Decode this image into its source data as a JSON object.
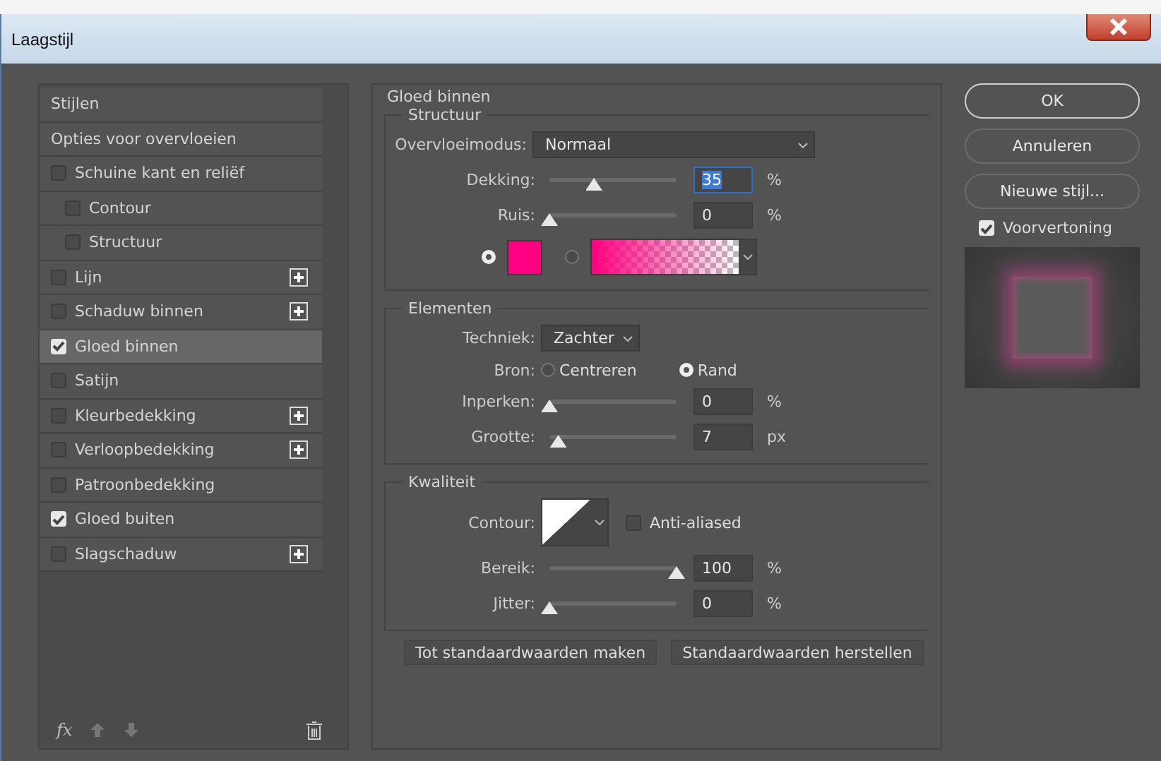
{
  "window": {
    "title": "Laagstijl"
  },
  "styles": [
    {
      "kind": "header",
      "label": "Stijlen",
      "selected": false
    },
    {
      "kind": "header",
      "label": "Opties voor overvloeien",
      "selected": false
    },
    {
      "kind": "check",
      "label": "Schuine kant en reliëf",
      "checked": false,
      "selected": false,
      "addable": false,
      "children": [
        {
          "kind": "check",
          "label": "Contour",
          "checked": false,
          "selected": false,
          "addable": false
        },
        {
          "kind": "check",
          "label": "Structuur",
          "checked": false,
          "selected": false,
          "addable": false
        }
      ]
    },
    {
      "kind": "check",
      "label": "Lijn",
      "checked": false,
      "selected": false,
      "addable": true
    },
    {
      "kind": "check",
      "label": "Schaduw binnen",
      "checked": false,
      "selected": false,
      "addable": true
    },
    {
      "kind": "check",
      "label": "Gloed binnen",
      "checked": true,
      "selected": true,
      "addable": false
    },
    {
      "kind": "check",
      "label": "Satijn",
      "checked": false,
      "selected": false,
      "addable": false
    },
    {
      "kind": "check",
      "label": "Kleurbedekking",
      "checked": false,
      "selected": false,
      "addable": true
    },
    {
      "kind": "check",
      "label": "Verloopbedekking",
      "checked": false,
      "selected": false,
      "addable": true
    },
    {
      "kind": "check",
      "label": "Patroonbedekking",
      "checked": false,
      "selected": false,
      "addable": false
    },
    {
      "kind": "check",
      "label": "Gloed buiten",
      "checked": true,
      "selected": false,
      "addable": false
    },
    {
      "kind": "check",
      "label": "Slagschaduw",
      "checked": false,
      "selected": false,
      "addable": true
    }
  ],
  "styles_footer": {
    "fx": "fx"
  },
  "panel": {
    "title": "Gloed binnen",
    "structure": {
      "title": "Structuur",
      "blend_label": "Overvloeimodus:",
      "blend_value": "Normaal",
      "sliders": [
        {
          "label": "Dekking:",
          "level": 0.35,
          "value": "35",
          "unit": "%",
          "focused": true
        },
        {
          "label": "Ruis:",
          "level": 0,
          "value": "0",
          "unit": "%",
          "focused": false
        }
      ],
      "fill": [
        {
          "kind": "solid",
          "selected": true,
          "color": "#ff0080"
        },
        {
          "kind": "gradient",
          "selected": false,
          "color": "#ff0080"
        }
      ]
    },
    "elements": {
      "title": "Elementen",
      "technique_label": "Techniek:",
      "technique_value": "Zachter",
      "source_label": "Bron:",
      "sources": [
        {
          "label": "Centreren",
          "selected": false
        },
        {
          "label": "Rand",
          "selected": true
        }
      ],
      "sliders": [
        {
          "label": "Inperken:",
          "level": 0,
          "value": "0",
          "unit": "%",
          "focused": false
        },
        {
          "label": "Grootte:",
          "level": 0.07,
          "value": "7",
          "unit": "px",
          "focused": false
        }
      ]
    },
    "quality": {
      "title": "Kwaliteit",
      "contour_label": "Contour:",
      "anti_aliased": {
        "label": "Anti-aliased",
        "checked": false
      },
      "sliders": [
        {
          "label": "Bereik:",
          "level": 1,
          "value": "100",
          "unit": "%",
          "focused": false
        },
        {
          "label": "Jitter:",
          "level": 0,
          "value": "0",
          "unit": "%",
          "focused": false
        }
      ]
    },
    "buttons": [
      "Tot standaardwaarden maken",
      "Standaardwaarden herstellen"
    ]
  },
  "actions": [
    {
      "label": "OK",
      "default": true
    },
    {
      "label": "Annuleren",
      "default": false
    },
    {
      "label": "Nieuwe stijl...",
      "default": false
    }
  ],
  "preview": {
    "label": "Voorvertoning",
    "checked": true
  }
}
